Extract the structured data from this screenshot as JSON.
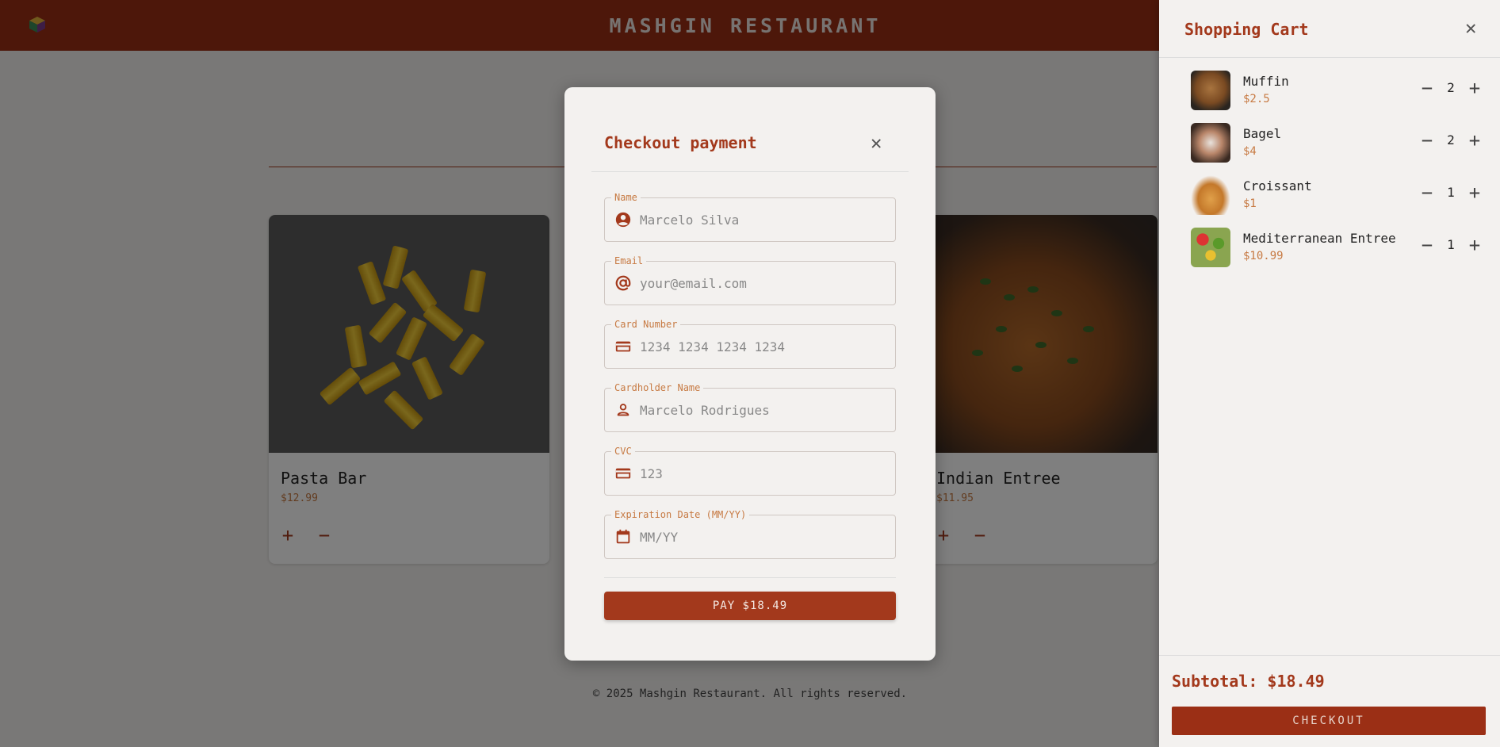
{
  "header": {
    "brand": "MASHGIN RESTAURANT",
    "logo_icon": "cube-logo-icon"
  },
  "menu_cards": [
    {
      "title": "Pasta Bar",
      "price": "$12.99",
      "add_icon": "plus-icon",
      "remove_icon": "minus-icon"
    },
    {
      "title": "Indian Entree",
      "price": "$11.95",
      "add_icon": "plus-icon",
      "remove_icon": "minus-icon"
    }
  ],
  "footer": {
    "text": "© 2025 Mashgin Restaurant. All rights reserved."
  },
  "cart": {
    "title": "Shopping Cart",
    "close_icon": "close-icon",
    "items": [
      {
        "name": "Muffin",
        "price": "$2.5",
        "qty": "2"
      },
      {
        "name": "Bagel",
        "price": "$4",
        "qty": "2"
      },
      {
        "name": "Croissant",
        "price": "$1",
        "qty": "1"
      },
      {
        "name": "Mediterranean Entree",
        "price": "$10.99",
        "qty": "1"
      }
    ],
    "subtotal": "Subtotal: $18.49",
    "checkout_label": "CHECKOUT"
  },
  "modal": {
    "title": "Checkout payment",
    "close_icon": "close-icon",
    "fields": [
      {
        "label": "Name",
        "value": "",
        "placeholder": "Marcelo Silva",
        "icon": "user-circle-icon"
      },
      {
        "label": "Email",
        "value": "",
        "placeholder": "your@email.com",
        "icon": "at-sign-icon"
      },
      {
        "label": "Card Number",
        "value": "",
        "placeholder": "1234 1234 1234 1234",
        "icon": "credit-card-icon"
      },
      {
        "label": "Cardholder Name",
        "value": "",
        "placeholder": "Marcelo Rodrigues",
        "icon": "user-icon"
      },
      {
        "label": "CVC",
        "value": "",
        "placeholder": "123",
        "icon": "credit-card-icon"
      },
      {
        "label": "Expiration Date (MM/YY)",
        "value": "",
        "placeholder": "MM/YY",
        "icon": "calendar-icon"
      }
    ],
    "pay_label": "PAY $18.49"
  },
  "colors": {
    "accent": "#a3391c",
    "header_bg": "#9b2f15",
    "price": "#c77a43",
    "surface": "#f3f1ef"
  }
}
